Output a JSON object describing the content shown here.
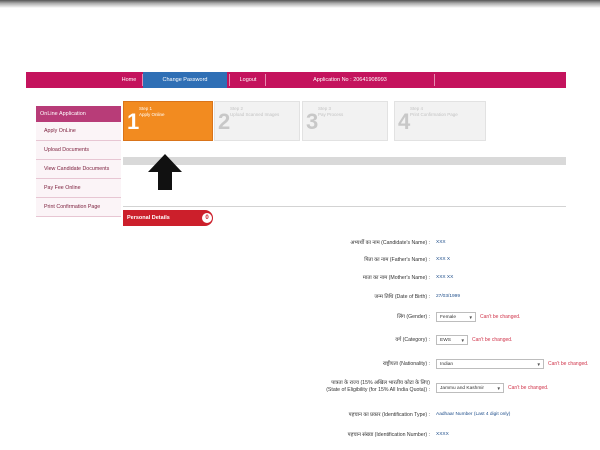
{
  "nav": {
    "home": "Home",
    "change_password": "Change Password",
    "logout": "Logout",
    "application_no": "Application No : 20641908993"
  },
  "sidebar": {
    "title": "OnLine Application",
    "items": [
      {
        "label": "Apply OnLine"
      },
      {
        "label": "Upload Documents"
      },
      {
        "label": "View Candidate Documents"
      },
      {
        "label": "Pay Fee Online"
      },
      {
        "label": "Print Confirmation Page"
      }
    ]
  },
  "steps": [
    {
      "num": "1",
      "label": "Step 1",
      "sub": "Apply Online",
      "active": true
    },
    {
      "num": "2",
      "label": "Step 2",
      "sub": "Upload Scanned Images",
      "active": false
    },
    {
      "num": "3",
      "label": "Step 3",
      "sub": "Pay Process",
      "active": false
    },
    {
      "num": "4",
      "label": "Step 4",
      "sub": "Print Confirmation Page",
      "active": false
    }
  ],
  "section": {
    "title": "Personal Details",
    "badge": "0"
  },
  "fields": {
    "candidate_name": {
      "label": "अभ्यर्थी का नाम (Candidate's Name) :",
      "value": "XXX"
    },
    "father_name": {
      "label": "पिता का नाम (Father's Name) :",
      "value": "XXX X"
    },
    "mother_name": {
      "label": "माता का नाम (Mother's Name) :",
      "value": "XXX XX"
    },
    "dob": {
      "label": "जन्म तिथि (Date of Birth) :",
      "value": "27/03/1999"
    },
    "gender": {
      "label": "लिंग (Gender) :",
      "value": "Female",
      "warning": "Can't be changed."
    },
    "category": {
      "label": "वर्ग (Category) :",
      "value": "EWS",
      "warning": "Can't be changed."
    },
    "nationality": {
      "label": "राष्ट्रीयता (Nationality) :",
      "value": "Indian",
      "warning": "Can't be changed."
    },
    "state": {
      "label_line1": "पात्रता के राज्य (15% अखिल भारतीय कोटा के लिए)",
      "label_line2": "(State of Eligibility (for 15% All India Quota)) :",
      "value": "Jammu and Kashmir",
      "warning": "Can't be changed."
    },
    "id_type": {
      "label": "पहचान का प्रकार (Identification Type) :",
      "value": "Aadhaar Number (Last 4 digit only)"
    },
    "id_number": {
      "label": "पहचान संख्या (Identification Number) :",
      "value": "XXXX"
    }
  }
}
